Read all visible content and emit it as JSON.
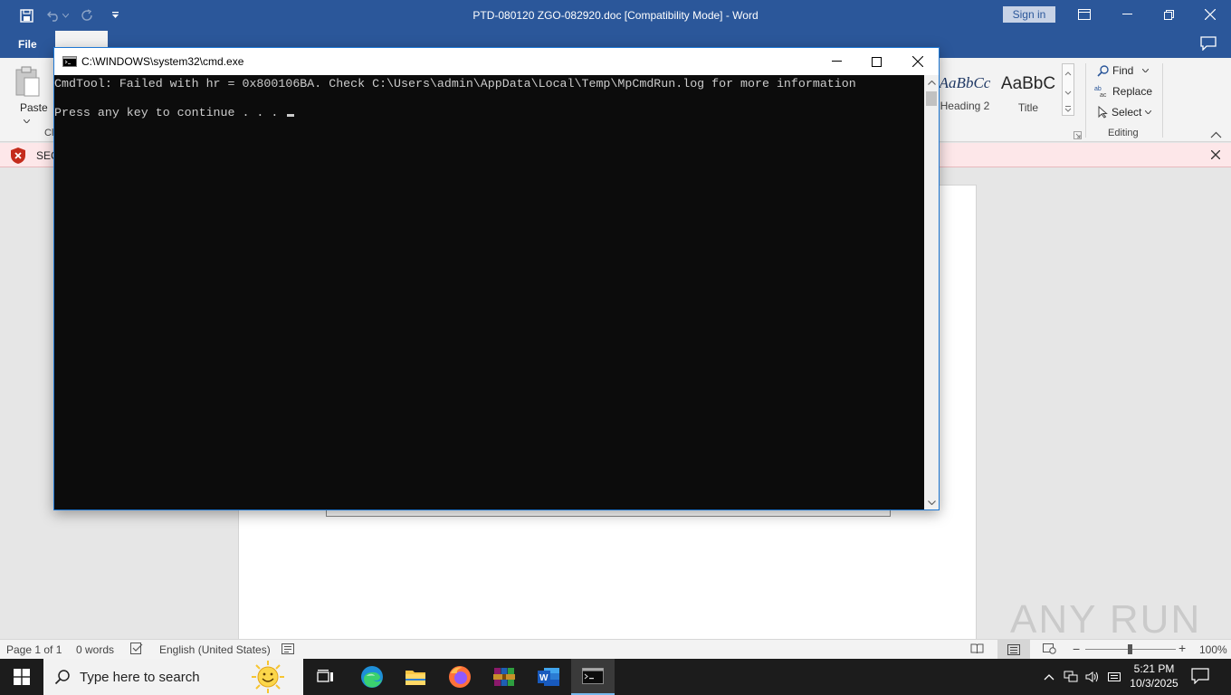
{
  "word": {
    "title": "PTD-080120 ZGO-082920.doc [Compatibility Mode]  -  Word",
    "sign_in": "Sign in",
    "tabs": {
      "file": "File"
    },
    "ribbon": {
      "paste": "Paste",
      "clipboard_group_partial": "Cl",
      "styles": [
        {
          "sample": "AaBbCc",
          "name": "Heading 2"
        },
        {
          "sample": "AaBbC",
          "name": "Title"
        }
      ],
      "find": "Find",
      "replace": "Replace",
      "select": "Select",
      "editing_group": "Editing"
    },
    "security_bar": {
      "text_partial": "SEC"
    },
    "status": {
      "page": "Page 1 of 1",
      "words": "0 words",
      "language": "English (United States)",
      "zoom": "100%"
    }
  },
  "cmd": {
    "title": "C:\\WINDOWS\\system32\\cmd.exe",
    "lines": [
      "CmdTool: Failed with hr = 0x800106BA. Check C:\\Users\\admin\\AppData\\Local\\Temp\\MpCmdRun.log for more information",
      "",
      "Press any key to continue . . . "
    ]
  },
  "watermark": "ANY RUN",
  "taskbar": {
    "search_placeholder": "Type here to search",
    "time": "5:21 PM",
    "date": "10/3/2025"
  }
}
